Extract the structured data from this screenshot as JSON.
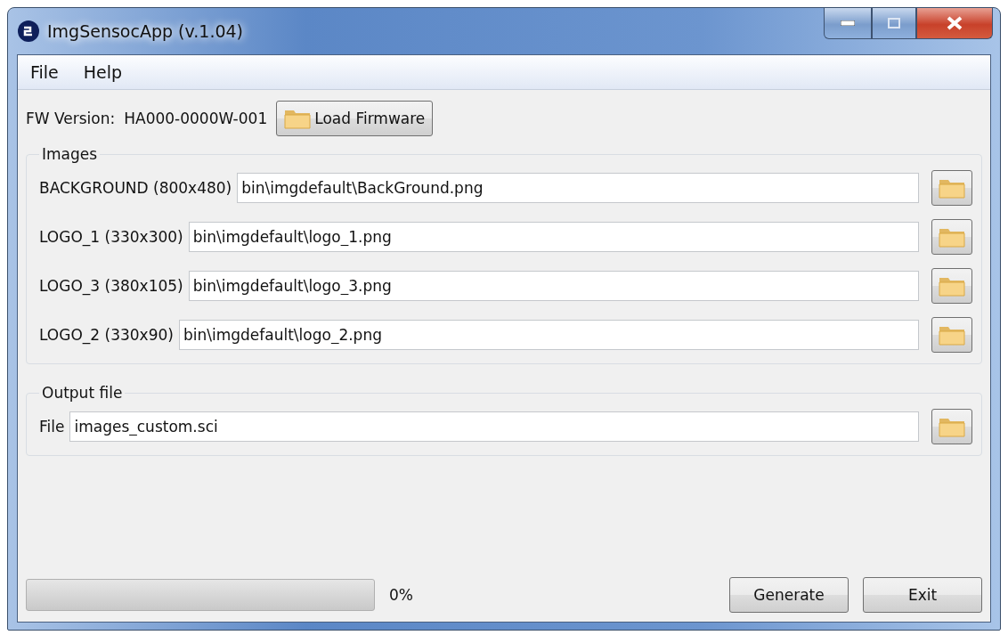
{
  "window": {
    "title": "ImgSensocApp (v.1.04)"
  },
  "menu": [
    "File",
    "Help"
  ],
  "firmware": {
    "label": "FW Version:",
    "version": "HA000-0000W-001",
    "button": "Load Firmware"
  },
  "images": {
    "title": "Images",
    "rows": [
      {
        "label": "BACKGROUND (800x480)",
        "value": "bin\\imgdefault\\BackGround.png"
      },
      {
        "label": "LOGO_1 (330x300)",
        "value": "bin\\imgdefault\\logo_1.png"
      },
      {
        "label": "LOGO_3 (380x105)",
        "value": "bin\\imgdefault\\logo_3.png"
      },
      {
        "label": "LOGO_2 (330x90)",
        "value": "bin\\imgdefault\\logo_2.png"
      }
    ]
  },
  "output": {
    "title": "Output file",
    "label": "File",
    "value": "images_custom.sci"
  },
  "progress": {
    "level": 0,
    "reading": "0%"
  },
  "buttons": [
    "Generate",
    "Exit"
  ]
}
